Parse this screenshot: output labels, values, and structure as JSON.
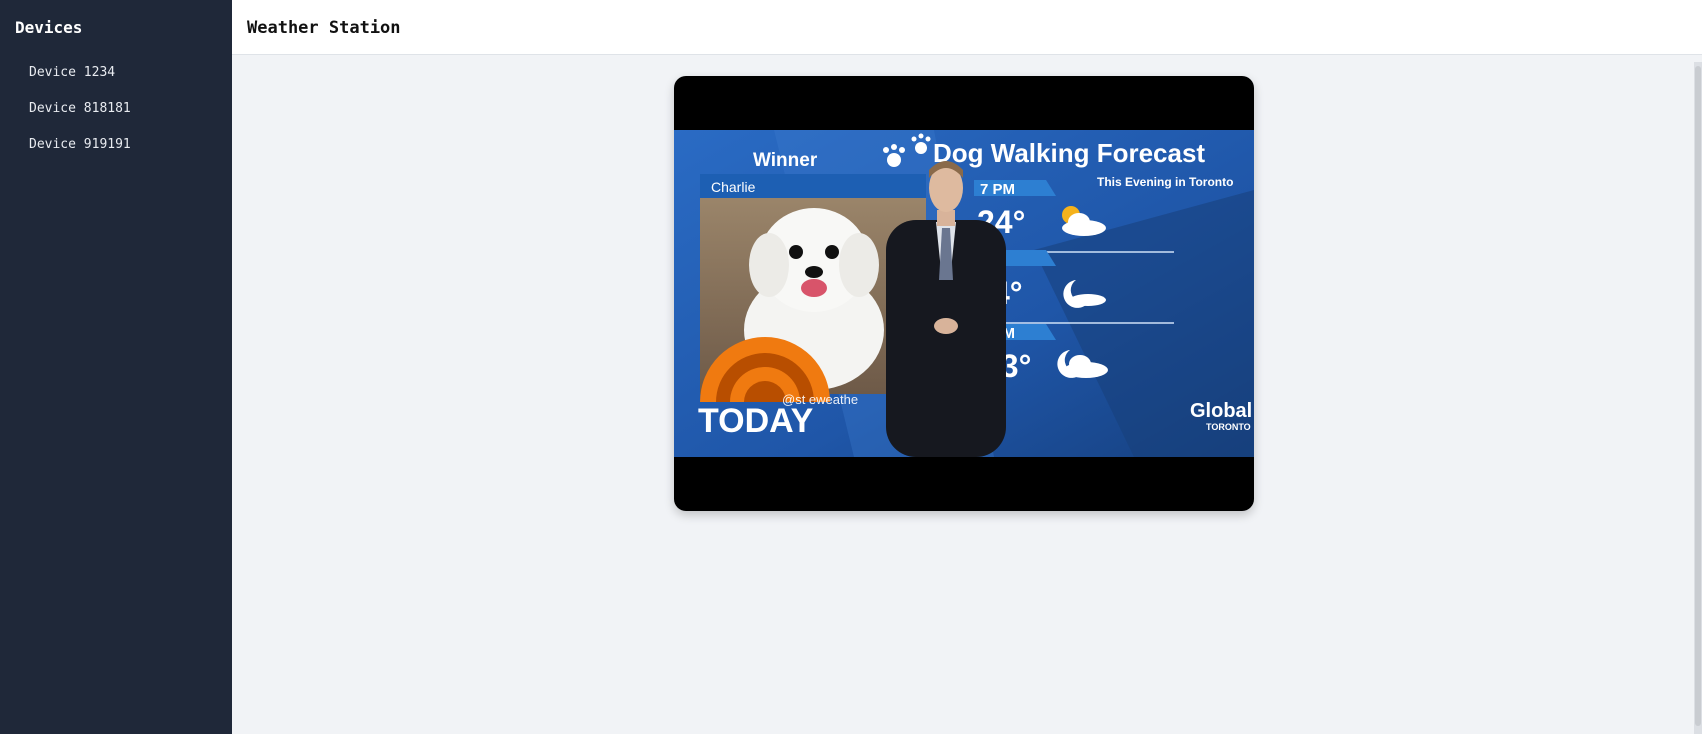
{
  "sidebar": {
    "title": "Devices",
    "items": [
      {
        "label": "Device 1234"
      },
      {
        "label": "Device 818181"
      },
      {
        "label": "Device 919191"
      }
    ]
  },
  "header": {
    "title": "Weather Station"
  },
  "video": {
    "overlay": {
      "forecast_title": "Dog Walking Forecast",
      "subtitle": "This Evening in Toronto",
      "winner_label": "Winner",
      "dog_name": "Charlie",
      "handle": "@st  eweathe",
      "today_logo": "TODAY",
      "network_logo": "Global",
      "network_city": "TORONTO",
      "forecast": [
        {
          "time": "7 PM",
          "temp": "24°",
          "icon": "sun-cloud-icon"
        },
        {
          "time": "PM",
          "temp": "4°",
          "icon": "moon-icon"
        },
        {
          "time": "1 PM",
          "temp": "23°",
          "icon": "moon-cloud-icon"
        }
      ]
    }
  },
  "colors": {
    "sidebar_bg": "#1f2839",
    "page_bg": "#f1f3f6",
    "weather_blue": "#1f5fb0",
    "today_orange": "#f07a10"
  }
}
